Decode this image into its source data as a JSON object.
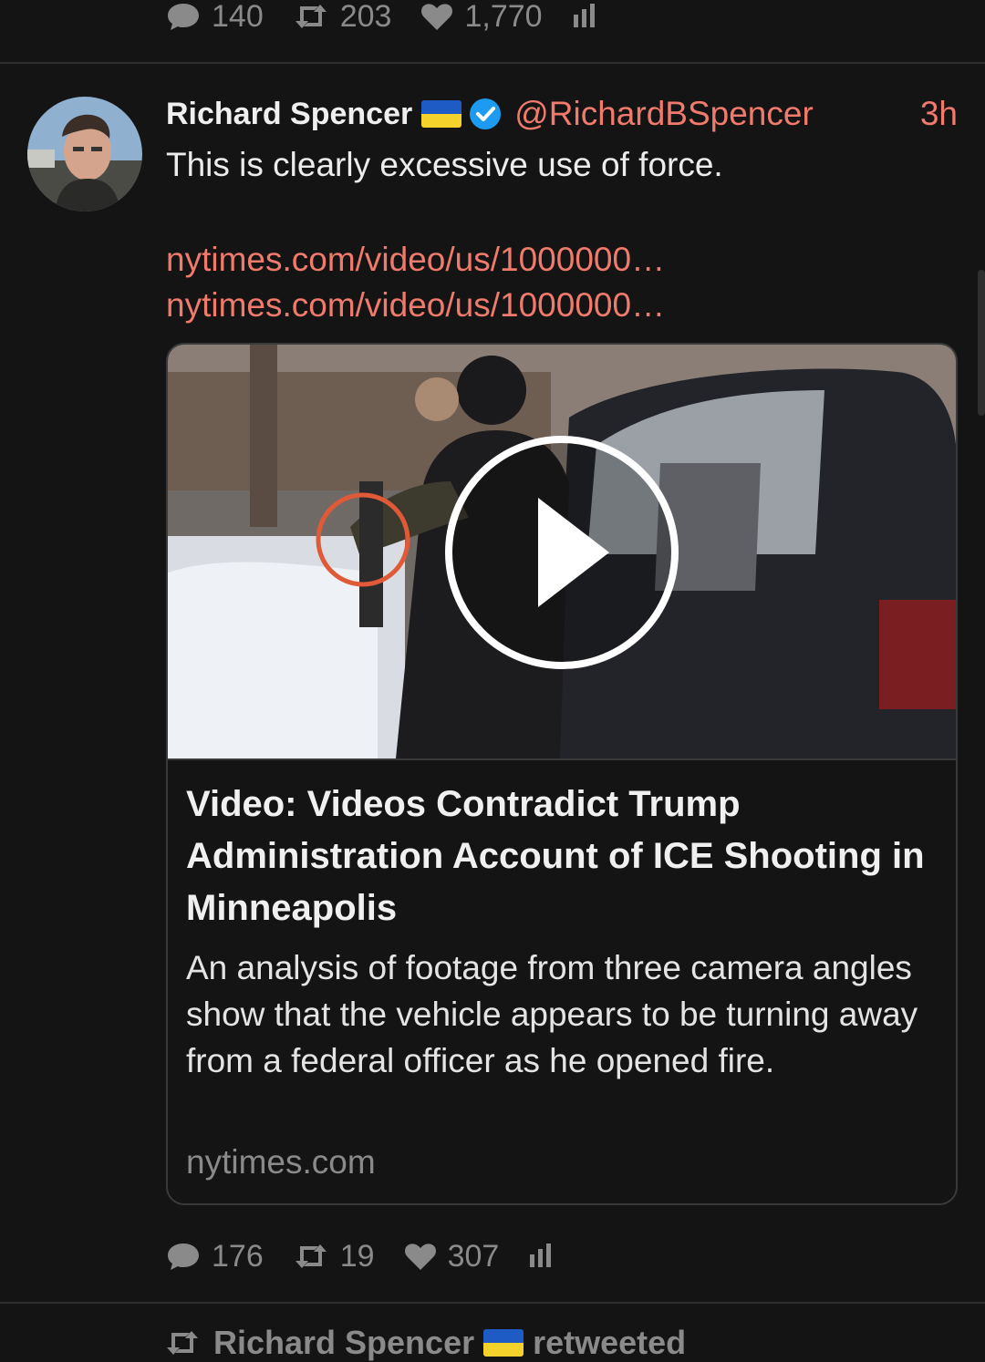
{
  "prev_tweet": {
    "stats": {
      "replies": "140",
      "retweets": "203",
      "likes": "1,770"
    }
  },
  "tweet": {
    "author_name": "Richard Spencer",
    "handle": "@RichardBSpencer",
    "time": "3h",
    "text": "This is clearly excessive use of force.",
    "links": [
      "nytimes.com/video/us/1000000…",
      "nytimes.com/video/us/1000000…"
    ],
    "card": {
      "title": "Video: Videos Contradict Trump Administration Account of ICE Shooting in Minneapolis",
      "description": "An analysis of footage from three camera angles show that the vehicle appears to be turning away from a federal officer as he opened fire.",
      "domain": "nytimes.com"
    },
    "stats": {
      "replies": "176",
      "retweets": "19",
      "likes": "307"
    }
  },
  "next_item": {
    "retweeter": "Richard Spencer",
    "action": "retweeted"
  },
  "colors": {
    "background": "#141414",
    "link": "#f07a6b",
    "muted": "#8a8a8a",
    "verified": "#1d9bf0",
    "flag_blue": "#1f5bc4",
    "flag_yellow": "#f4d22b"
  }
}
